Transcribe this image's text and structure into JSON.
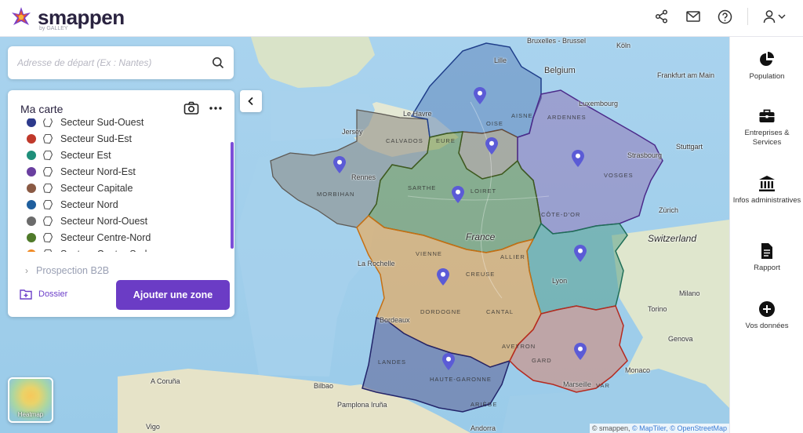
{
  "app": {
    "brand": "smappen",
    "brand_sub": "by GALLEY"
  },
  "search": {
    "placeholder": "Adresse de départ (Ex : Nantes)"
  },
  "panel": {
    "title": "Ma carte",
    "items": [
      {
        "label": "Secteur Sud-Ouest",
        "color": "#2d3a8c"
      },
      {
        "label": "Secteur Sud-Est",
        "color": "#c0392b"
      },
      {
        "label": "Secteur Est",
        "color": "#1f8f7a"
      },
      {
        "label": "Secteur Nord-Est",
        "color": "#6a3fa0"
      },
      {
        "label": "Secteur Capitale",
        "color": "#8a5a44"
      },
      {
        "label": "Secteur Nord",
        "color": "#1f5f9e"
      },
      {
        "label": "Secteur Nord-Ouest",
        "color": "#6b6b6b"
      },
      {
        "label": "Secteur Centre-Nord",
        "color": "#4f7a2a"
      },
      {
        "label": "Secteur Centre-Sud",
        "color": "#f08a24"
      }
    ],
    "folder": "Prospection B2B",
    "dossier_label": "Dossier",
    "add_zone_label": "Ajouter une zone"
  },
  "heatmap": {
    "label": "Heatmap"
  },
  "sidebar": {
    "items": [
      {
        "label": "Population",
        "icon": "pie-chart-icon"
      },
      {
        "label": "Entreprises & Services",
        "icon": "briefcase-icon"
      },
      {
        "label": "Infos administratives",
        "icon": "bank-icon"
      },
      {
        "label": "Rapport",
        "icon": "document-icon"
      },
      {
        "label": "Vos données",
        "icon": "plus-circle-icon"
      }
    ]
  },
  "map": {
    "cities": {
      "bruxelles": "Bruxelles - Brussel",
      "koln": "Köln",
      "lille": "Lille",
      "belgium": "Belgium",
      "frankfurt": "Frankfurt am Main",
      "luxembourg": "Luxembourg",
      "lehavre": "Le Havre",
      "stuttgart": "Stuttgart",
      "strasbourg": "Strasbourg",
      "jersey": "Jersey",
      "rennes": "Rennes",
      "zurich": "Zürich",
      "france": "France",
      "switzerland": "Switzerland",
      "larochelle": "La Rochelle",
      "lyon": "Lyon",
      "milano": "Milano",
      "bordeaux": "Bordeaux",
      "genova": "Genova",
      "monaco": "Monaco",
      "marseille": "Marseille",
      "acoruna": "A Coruña",
      "bilbao": "Bilbao",
      "pamplona": "Pamplona Iruña",
      "vigo": "Vigo",
      "andorra": "Andorra",
      "torino": "Torino"
    },
    "regions": {
      "calvados": "CALVADOS",
      "eure": "EURE",
      "oise": "OISE",
      "aisne": "AISNE",
      "ardennes": "ARDENNES",
      "vosges": "VOSGES",
      "morbihan": "MORBIHAN",
      "sarthe": "SARTHE",
      "loiret": "LOIRET",
      "cotedor": "CÔTE-D'OR",
      "vienne": "VIENNE",
      "allier": "ALLIER",
      "creuse": "CREUSE",
      "dordogne": "DORDOGNE",
      "cantal": "CANTAL",
      "aveyron": "AVEYRON",
      "landes": "LANDES",
      "gard": "GARD",
      "var": "VAR",
      "hautegaronne": "HAUTE-GARONNE",
      "ariege": "ARIÈGE"
    },
    "attribution": {
      "smappen": "© smappen,",
      "maptiler": "© MapTiler,",
      "osm": "© OpenStreetMap"
    }
  }
}
